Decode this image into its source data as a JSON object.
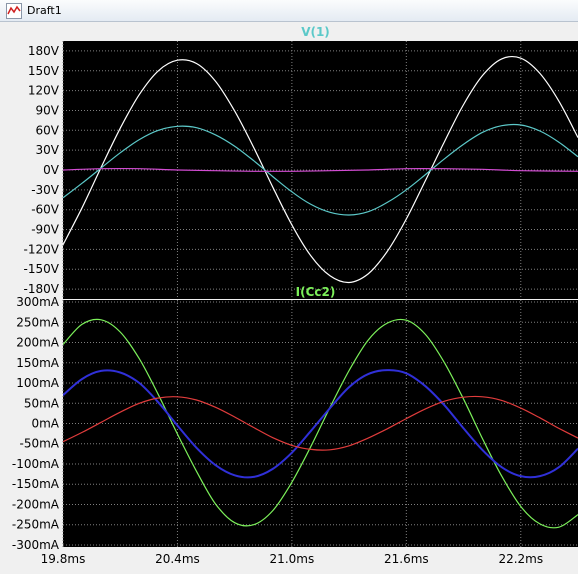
{
  "window": {
    "title": "Draft1",
    "icon": "waveform-icon"
  },
  "colors": {
    "plot_background": "#000000",
    "grid": "#7f7f7f",
    "axis_text": "#000000",
    "trace_white": "#ffffff",
    "trace_cyan": "#5cc9c9",
    "trace_magenta": "#d24cd2",
    "trace_green": "#7cf05a",
    "trace_blue": "#3030d8",
    "trace_red": "#e03c3c"
  },
  "chart_data": [
    {
      "type": "line",
      "title": "V(1)",
      "title_color": "#5cc9c9",
      "xlim": [
        19.8,
        22.5
      ],
      "ylim": [
        -195,
        195
      ],
      "y_ticks": [
        180,
        150,
        120,
        90,
        60,
        30,
        0,
        -30,
        -60,
        -90,
        -120,
        -150,
        -180
      ],
      "y_tick_labels": [
        "180V",
        "150V",
        "120V",
        "90V",
        "60V",
        "30V",
        "0V",
        "-30V",
        "-60V",
        "-90V",
        "-120V",
        "-150V",
        "-180V"
      ],
      "x_ticks": [
        19.8,
        20.4,
        21.0,
        21.6,
        22.2
      ],
      "grid": true,
      "series": [
        {
          "color": "#ffffff",
          "x": [
            19.8,
            19.9,
            20.0,
            20.1,
            20.2,
            20.3,
            20.4,
            20.5,
            20.6,
            20.7,
            20.8,
            20.9,
            21.0,
            21.1,
            21.2,
            21.3,
            21.4,
            21.5,
            21.6,
            21.7,
            21.8,
            21.9,
            22.0,
            22.1,
            22.2,
            22.3,
            22.4,
            22.5
          ],
          "y": [
            -113,
            -57,
            4,
            63,
            114,
            150,
            166,
            161,
            134,
            89,
            34,
            -26,
            -83,
            -130,
            -160,
            -170,
            -157,
            -123,
            -74,
            -16,
            43,
            99,
            143,
            168,
            169,
            146,
            104,
            49
          ]
        },
        {
          "color": "#5cc9c9",
          "x": [
            19.8,
            19.9,
            20.0,
            20.1,
            20.2,
            20.3,
            20.4,
            20.5,
            20.6,
            20.7,
            20.8,
            20.9,
            21.0,
            21.1,
            21.2,
            21.3,
            21.4,
            21.5,
            21.6,
            21.7,
            21.8,
            21.9,
            22.0,
            22.1,
            22.2,
            22.3,
            22.4,
            22.5
          ],
          "y": [
            -42,
            -20,
            3,
            26,
            46,
            60,
            66,
            64,
            53,
            36,
            14,
            -10,
            -33,
            -52,
            -64,
            -68,
            -63,
            -49,
            -30,
            -7,
            17,
            39,
            57,
            67,
            68,
            59,
            42,
            20
          ]
        },
        {
          "color": "#d24cd2",
          "x": [
            19.8,
            20.0,
            20.2,
            20.4,
            20.6,
            20.8,
            21.0,
            21.2,
            21.4,
            21.6,
            21.8,
            22.0,
            22.2,
            22.5
          ],
          "y": [
            0,
            2,
            2,
            0,
            -1,
            -2,
            -2,
            -1,
            0,
            2,
            2,
            1,
            -1,
            -2
          ]
        }
      ]
    },
    {
      "type": "line",
      "title": "I(Cc2)",
      "title_color": "#7cf05a",
      "xlim": [
        19.8,
        22.5
      ],
      "ylim": [
        -305,
        305
      ],
      "y_ticks": [
        300,
        250,
        200,
        150,
        100,
        50,
        0,
        -50,
        -100,
        -150,
        -200,
        -250,
        -300
      ],
      "y_tick_labels": [
        "300mA",
        "250mA",
        "200mA",
        "150mA",
        "100mA",
        "50mA",
        "0mA",
        "-50mA",
        "-100mA",
        "-150mA",
        "-200mA",
        "-250mA",
        "-300mA"
      ],
      "x_ticks": [
        19.8,
        20.4,
        21.0,
        21.6,
        22.2
      ],
      "x_tick_labels": [
        "19.8ms",
        "20.4ms",
        "21.0ms",
        "21.6ms",
        "22.2ms"
      ],
      "grid": true,
      "series": [
        {
          "color": "#7cf05a",
          "x": [
            19.8,
            19.9,
            20.0,
            20.1,
            20.2,
            20.3,
            20.4,
            20.5,
            20.6,
            20.7,
            20.8,
            20.9,
            21.0,
            21.1,
            21.2,
            21.3,
            21.4,
            21.5,
            21.6,
            21.7,
            21.8,
            21.9,
            22.0,
            22.1,
            22.2,
            22.3,
            22.4,
            22.5
          ],
          "y": [
            195,
            245,
            256,
            226,
            160,
            71,
            -26,
            -118,
            -199,
            -245,
            -250,
            -215,
            -145,
            -56,
            40,
            131,
            206,
            248,
            255,
            220,
            150,
            60,
            -38,
            -130,
            -205,
            -248,
            -256,
            -225
          ]
        },
        {
          "color": "#3030d8",
          "x": [
            19.8,
            19.9,
            20.0,
            20.1,
            20.2,
            20.3,
            20.4,
            20.5,
            20.6,
            20.7,
            20.8,
            20.9,
            21.0,
            21.1,
            21.2,
            21.3,
            21.4,
            21.5,
            21.6,
            21.7,
            21.8,
            21.9,
            22.0,
            22.1,
            22.2,
            22.3,
            22.4,
            22.5
          ],
          "y": [
            70,
            110,
            130,
            126,
            100,
            52,
            -5,
            -60,
            -103,
            -128,
            -132,
            -112,
            -72,
            -18,
            38,
            90,
            122,
            132,
            124,
            92,
            45,
            -12,
            -66,
            -108,
            -130,
            -130,
            -108,
            -62
          ]
        },
        {
          "color": "#e03c3c",
          "x": [
            19.8,
            19.9,
            20.0,
            20.1,
            20.2,
            20.3,
            20.4,
            20.5,
            20.6,
            20.7,
            20.8,
            20.9,
            21.0,
            21.1,
            21.2,
            21.3,
            21.4,
            21.5,
            21.6,
            21.7,
            21.8,
            21.9,
            22.0,
            22.1,
            22.2,
            22.3,
            22.4,
            22.5
          ],
          "y": [
            -45,
            -22,
            3,
            28,
            50,
            63,
            66,
            58,
            40,
            16,
            -10,
            -35,
            -54,
            -64,
            -65,
            -55,
            -36,
            -13,
            12,
            36,
            55,
            65,
            66,
            57,
            38,
            14,
            -12,
            -36
          ]
        }
      ]
    }
  ]
}
